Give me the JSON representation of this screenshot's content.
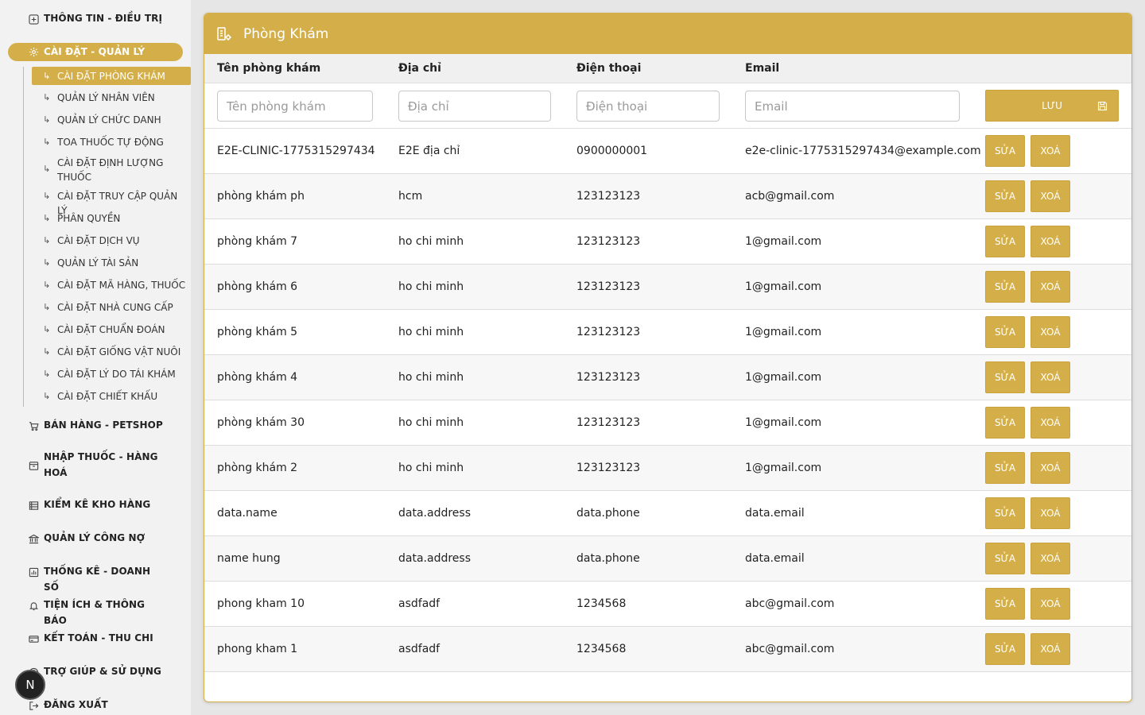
{
  "sidebar": {
    "sections": [
      {
        "label": "THÔNG TIN - ĐIỀU TRỊ",
        "icon": "medical-cross-icon"
      },
      {
        "label": "CÀI ĐẶT - QUẢN LÝ",
        "icon": "gear-icon"
      },
      {
        "label": "BÁN HÀNG - PETSHOP",
        "icon": "cart-icon"
      },
      {
        "label": "NHẬP THUỐC - HÀNG HOÁ",
        "icon": "box-icon"
      },
      {
        "label": "KIỂM KÊ KHO HÀNG",
        "icon": "list-icon"
      },
      {
        "label": "QUẢN LÝ CÔNG NỢ",
        "icon": "bank-icon"
      },
      {
        "label": "THỐNG KÊ - DOANH SỐ",
        "icon": "chart-icon"
      },
      {
        "label": "TIỆN ÍCH & THÔNG BÁO",
        "icon": "bell-icon"
      },
      {
        "label": "KẾT TOÁN - THU CHI",
        "icon": "card-icon"
      },
      {
        "label": "TRỢ GIÚP & SỬ DỤNG",
        "icon": "help-icon"
      },
      {
        "label": "ĐĂNG XUẤT",
        "icon": "logout-icon"
      }
    ],
    "sub_items": [
      "CÀI ĐẶT PHÒNG KHÁM",
      "QUẢN LÝ NHÂN VIÊN",
      "QUẢN LÝ CHỨC DANH",
      "TOA THUỐC TỰ ĐỘNG",
      "CÀI ĐẶT ĐỊNH LƯỢNG THUỐC",
      "CÀI ĐẶT TRUY CẬP QUẢN LÝ",
      "PHÂN QUYỀN",
      "CÀI ĐẶT DỊCH VỤ",
      "QUẢN LÝ TÀI SẢN",
      "CÀI ĐẶT MÃ HÀNG, THUỐC",
      "CÀI ĐẶT NHÀ CUNG CẤP",
      "CÀI ĐẶT CHUẨN ĐOÁN",
      "CÀI ĐẶT GIỐNG VẬT NUÔI",
      "CÀI ĐẶT LÝ DO TÁI KHÁM",
      "CÀI ĐẶT CHIẾT KHẤU"
    ],
    "badge": "N"
  },
  "page": {
    "title": "Phòng Khám",
    "columns": [
      "Tên phòng khám",
      "Địa chỉ",
      "Điện thoại",
      "Email"
    ],
    "placeholders": {
      "name": "Tên phòng khám",
      "address": "Địa chỉ",
      "phone": "Điện thoại",
      "email": "Email"
    },
    "save_label": "LƯU",
    "edit_label": "SỬA",
    "delete_label": "XOÁ",
    "accent_color": "#d4af49",
    "rows": [
      {
        "name": "E2E-CLINIC-1775315297434",
        "address": "E2E địa chỉ",
        "phone": "0900000001",
        "email": "e2e-clinic-1775315297434@example.com"
      },
      {
        "name": "phòng khám ph",
        "address": "hcm",
        "phone": "123123123",
        "email": "acb@gmail.com"
      },
      {
        "name": "phòng khám 7",
        "address": "ho chi minh",
        "phone": "123123123",
        "email": "1@gmail.com"
      },
      {
        "name": "phòng khám 6",
        "address": "ho chi minh",
        "phone": "123123123",
        "email": "1@gmail.com"
      },
      {
        "name": "phòng khám 5",
        "address": "ho chi minh",
        "phone": "123123123",
        "email": "1@gmail.com"
      },
      {
        "name": "phòng khám 4",
        "address": "ho chi minh",
        "phone": "123123123",
        "email": "1@gmail.com"
      },
      {
        "name": "phòng khám 30",
        "address": "ho chi minh",
        "phone": "123123123",
        "email": "1@gmail.com"
      },
      {
        "name": "phòng khám 2",
        "address": "ho chi minh",
        "phone": "123123123",
        "email": "1@gmail.com"
      },
      {
        "name": "data.name",
        "address": "data.address",
        "phone": "data.phone",
        "email": "data.email"
      },
      {
        "name": "name hung",
        "address": "data.address",
        "phone": "data.phone",
        "email": "data.email"
      },
      {
        "name": "phong kham 10",
        "address": "asdfadf",
        "phone": "1234568",
        "email": "abc@gmail.com"
      },
      {
        "name": "phong kham 1",
        "address": "asdfadf",
        "phone": "1234568",
        "email": "abc@gmail.com"
      }
    ]
  }
}
